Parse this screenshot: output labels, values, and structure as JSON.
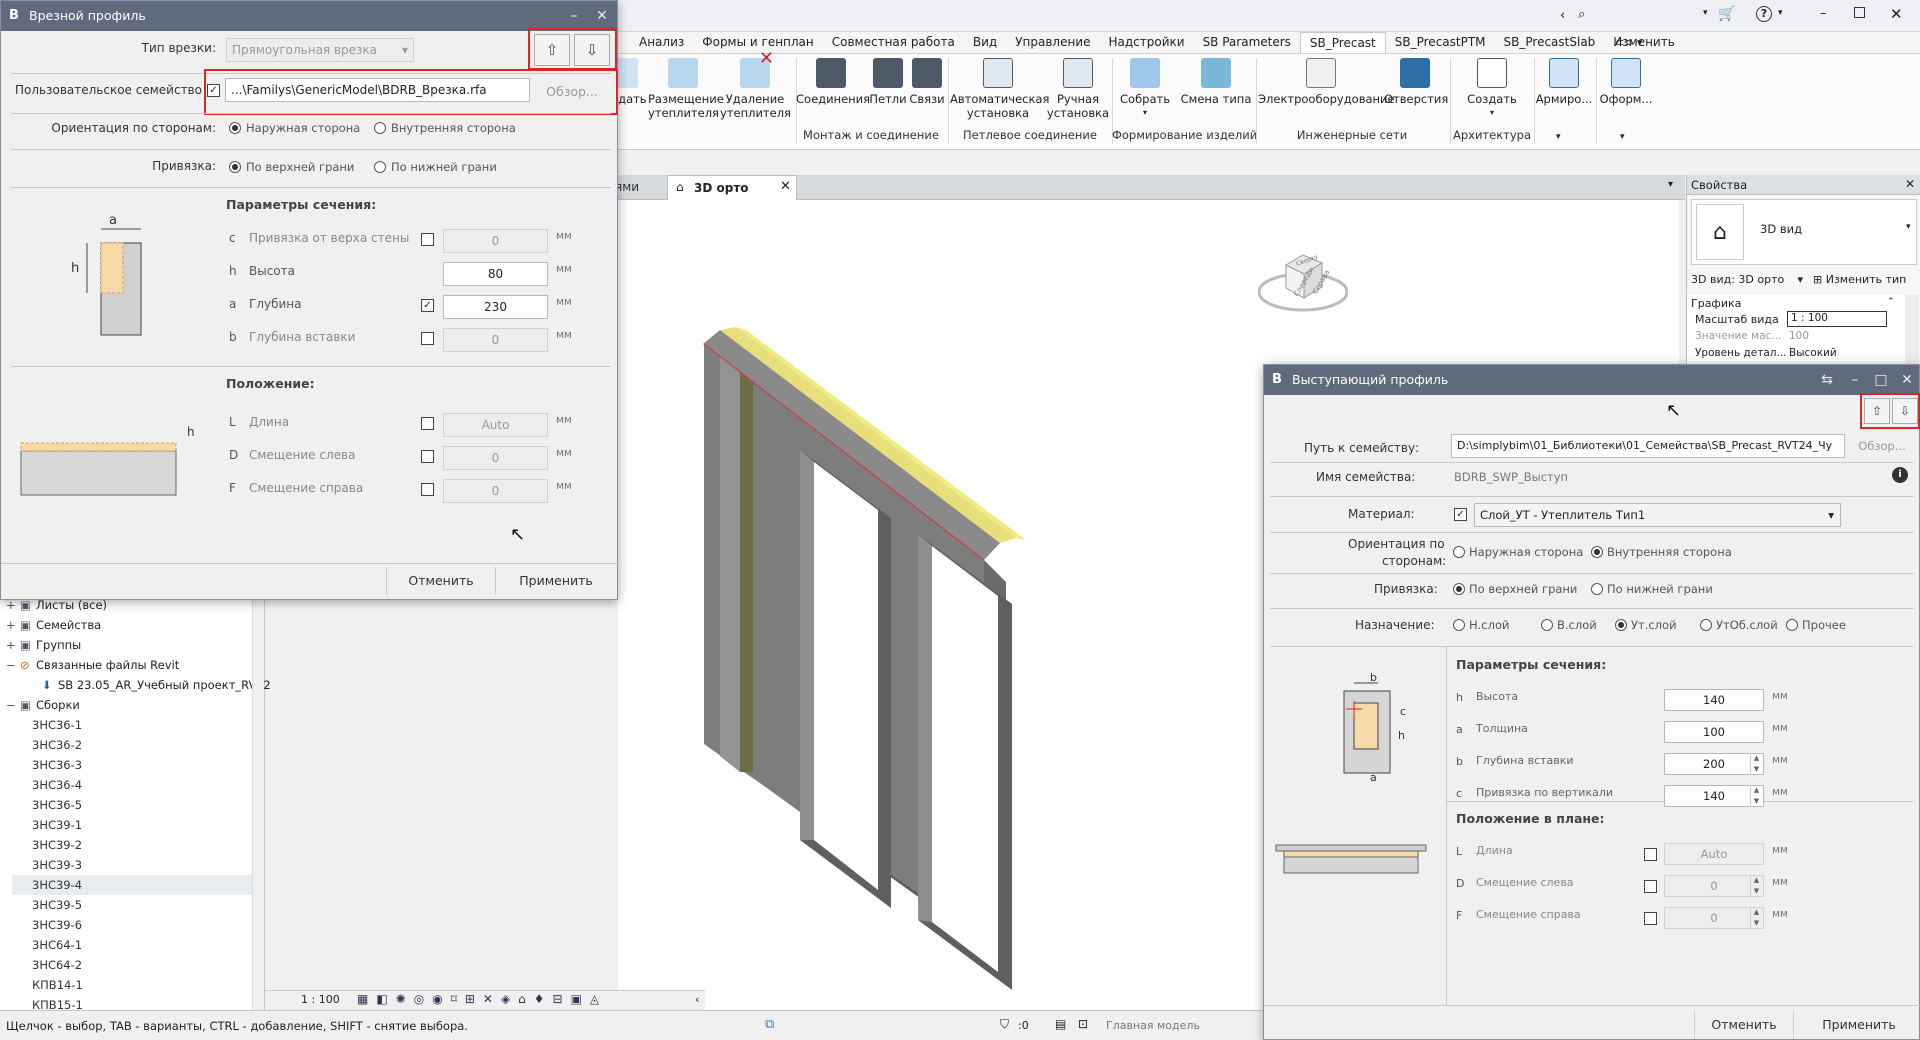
{
  "ribbon": {
    "tabs": [
      "Анализ",
      "Формы и генплан",
      "Совместная работа",
      "Вид",
      "Управление",
      "Надстройки",
      "SB Parameters",
      "SB_Precast",
      "SB_PrecastPTM",
      "SB_PrecastSlab",
      "Изменить"
    ],
    "active_tab": "SB_Precast",
    "buttons": {
      "create_ins": "здать",
      "place_ins": "Размещение утеплителя",
      "del_ins": "Удаление утеплителя",
      "joints": "Соединения",
      "loops": "Петли",
      "ties": "Связи",
      "auto_install": "Автоматическая установка",
      "manual_install": "Ручная установка",
      "assemble": "Собрать",
      "change_type": "Смена типа",
      "electrical": "Электрооборудование",
      "openings": "Отверстия",
      "create": "Создать",
      "rebar": "Армиро...",
      "format": "Оформ..."
    },
    "panels": {
      "mount": "Монтаж и соединение",
      "loop_conn": "Петлевое соединение",
      "forming": "Формирование изделий",
      "networks": "Инженерные сети",
      "arch": "Архитектура"
    }
  },
  "viewtabs": {
    "prev": "ями",
    "current": "3D орто"
  },
  "properties": {
    "title": "Свойства",
    "type_name": "3D вид",
    "view_selector": "3D вид: 3D орто",
    "edit_type": "Изменить тип",
    "group_graphics": "Графика",
    "scale_label": "Масштаб вида",
    "scale_value": "1 : 100",
    "scale_val_label": "Значение мас...",
    "scale_val_value": "100",
    "detail_label": "Уровень детал...",
    "detail_value": "Высокий"
  },
  "viewcube": {
    "face1": "Спереди",
    "face2": "Справа",
    "top": "Сверху"
  },
  "browser": {
    "items": [
      {
        "t": "Листы (все)",
        "icon": "sheet-icon"
      },
      {
        "t": "Семейства",
        "icon": "family-icon"
      },
      {
        "t": "Группы",
        "icon": "group-icon"
      },
      {
        "t": "Связанные файлы Revit",
        "icon": "link-icon"
      },
      {
        "t": "SB 23.05_AR_Учебный проект_RVT2",
        "icon": "linked-file-icon"
      },
      {
        "t": "Сборки",
        "icon": "assembly-icon"
      }
    ],
    "assemblies": [
      "3НС36-1",
      "3НС36-2",
      "3НС36-3",
      "3НС36-4",
      "3НС36-5",
      "3НС39-1",
      "3НС39-2",
      "3НС39-3",
      "3НС39-4",
      "3НС39-5",
      "3НС39-6",
      "3НС64-1",
      "3НС64-2",
      "КПВ14-1",
      "КПВ15-1"
    ]
  },
  "viewbar": {
    "scale": "1 : 100"
  },
  "status": {
    "hint": "Щелчок - выбор, TAB - варианты, CTRL - добавление, SHIFT - снятие выбора.",
    "selected_count": ":0",
    "model": "Главная модель"
  },
  "dlg1": {
    "title": "Врезной профиль",
    "type_label": "Тип врезки:",
    "type_value": "Прямоугольная врезка",
    "family_label": "Пользовательское семейство",
    "family_path": "...\\Familys\\GenericModel\\BDRB_Врезка.rfa",
    "browse": "Обзор...",
    "orient_label": "Ориентация по сторонам:",
    "orient_outer": "Наружная сторона",
    "orient_inner": "Внутренняя сторона",
    "bind_label": "Привязка:",
    "bind_top": "По верхней грани",
    "bind_bottom": "По нижней грани",
    "section_title": "Параметры сечения:",
    "fig1_a": "a",
    "fig1_h": "h",
    "params": [
      {
        "l": "c",
        "name": "Привязка от верха стены",
        "checked": false,
        "value": "0",
        "enabled": false,
        "unit": "мм"
      },
      {
        "l": "h",
        "name": "Высота",
        "checked": null,
        "value": "80",
        "enabled": true,
        "unit": "мм"
      },
      {
        "l": "a",
        "name": "Глубина",
        "checked": true,
        "value": "230",
        "enabled": true,
        "unit": "мм"
      },
      {
        "l": "b",
        "name": "Глубина вставки",
        "checked": false,
        "value": "0",
        "enabled": false,
        "unit": "мм"
      }
    ],
    "position_title": "Положение:",
    "fig2_h": "h",
    "position": [
      {
        "l": "L",
        "name": "Длина",
        "value": "Auto",
        "unit": "мм"
      },
      {
        "l": "D",
        "name": "Смещение слева",
        "value": "0",
        "unit": "мм"
      },
      {
        "l": "F",
        "name": "Смещение справа",
        "value": "0",
        "unit": "мм"
      }
    ],
    "cancel": "Отменить",
    "apply": "Применить"
  },
  "dlg2": {
    "title": "Выступающий профиль",
    "path_label": "Путь к семейству:",
    "path_value": "D:\\simplybim\\01_Библиотеки\\01_Семейства\\SB_Precast_RVT24_Чу",
    "browse": "Обзор...",
    "name_label": "Имя семейства:",
    "name_value": "BDRB_SWP_Выступ",
    "material_label": "Материал:",
    "material_value": "Слой_УТ - Утеплитель Тип1",
    "orient_label1": "Ориентация по",
    "orient_label2": "сторонам:",
    "orient_outer": "Наружная сторона",
    "orient_inner": "Внутренняя сторона",
    "bind_label": "Привязка:",
    "bind_top": "По верхней грани",
    "bind_bottom": "По нижней грани",
    "purpose_label": "Назначение:",
    "purpose": [
      "Н.слой",
      "В.слой",
      "Ут.слой",
      "УтОб.слой",
      "Прочее"
    ],
    "section_title": "Параметры сечения:",
    "fig1_b": "b",
    "fig1_c": "c",
    "fig1_h": "h",
    "fig1_a": "a",
    "params": [
      {
        "l": "h",
        "name": "Высота",
        "value": "140",
        "unit": "мм"
      },
      {
        "l": "a",
        "name": "Толщина",
        "value": "100",
        "unit": "мм"
      },
      {
        "l": "b",
        "name": "Глубина вставки",
        "value": "200",
        "unit": "мм"
      },
      {
        "l": "c",
        "name": "Привязка по вертикали",
        "value": "140",
        "unit": "мм"
      }
    ],
    "position_title": "Положение в плане:",
    "position": [
      {
        "l": "L",
        "name": "Длина",
        "value": "Auto",
        "unit": "мм"
      },
      {
        "l": "D",
        "name": "Смещение слева",
        "value": "0",
        "unit": "мм"
      },
      {
        "l": "F",
        "name": "Смещение справа",
        "value": "0",
        "unit": "мм"
      }
    ],
    "cancel": "Отменить",
    "apply": "Применить"
  }
}
